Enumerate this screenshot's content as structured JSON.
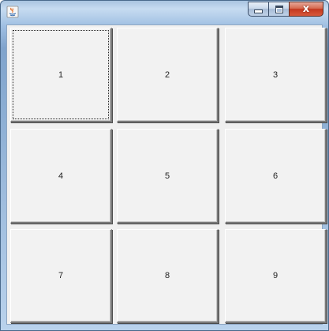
{
  "window": {
    "icon": "java-coffee-icon",
    "buttons": {
      "minimize_icon": "minimize-icon",
      "maximize_icon": "maximize-icon",
      "close_label": "x"
    },
    "accent_color": "#c4381f"
  },
  "grid": {
    "buttons": [
      {
        "label": "1",
        "focused": true
      },
      {
        "label": "2"
      },
      {
        "label": "3"
      },
      {
        "label": "4"
      },
      {
        "label": "5"
      },
      {
        "label": "6"
      },
      {
        "label": "7"
      },
      {
        "label": "8"
      },
      {
        "label": "9"
      }
    ]
  }
}
